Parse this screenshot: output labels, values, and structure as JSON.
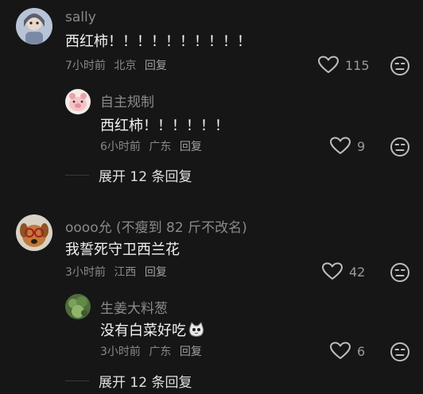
{
  "comments": [
    {
      "username": "sally",
      "text": "西红柿！！！！！！！！！！",
      "time": "7小时前",
      "location": "北京",
      "reply_label": "回复",
      "likes": "115",
      "avatar_icon": "girl-avatar"
    },
    {
      "username": "自主规制",
      "text": "西红柿！！！！！！",
      "time": "6小时前",
      "location": "广东",
      "reply_label": "回复",
      "likes": "9",
      "avatar_icon": "pig-avatar"
    },
    {
      "username": "oooo允 (不瘦到 82 斤不改名)",
      "text": "我誓死守卫西兰花",
      "time": "3小时前",
      "location": "江西",
      "reply_label": "回复",
      "likes": "42",
      "avatar_icon": "dog-avatar"
    },
    {
      "username": "生姜大料葱",
      "text": "没有白菜好吃",
      "time": "3小时前",
      "location": "广东",
      "reply_label": "回复",
      "likes": "6",
      "avatar_icon": "plant-avatar",
      "emoji_icon": "cat-face-icon"
    }
  ],
  "expand_replies": [
    {
      "label": "展开 12 条回复"
    },
    {
      "label": "展开 12 条回复"
    }
  ],
  "colors": {
    "background": "#161616",
    "username": "#8a8a8a",
    "text": "#f2f2f2",
    "meta": "#888888"
  }
}
